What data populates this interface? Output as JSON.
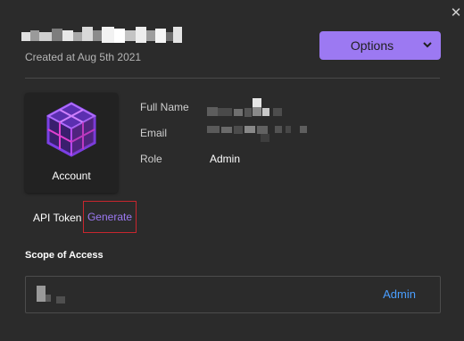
{
  "header": {
    "created": "Created at Aug 5th 2021",
    "options_label": "Options",
    "close_icon": "close-icon",
    "chevron_icon": "chevron-down-icon"
  },
  "account_card": {
    "label": "Account",
    "icon": "cube-logo-icon"
  },
  "fields": [
    {
      "label": "Full Name",
      "value": ""
    },
    {
      "label": "Email",
      "value": ""
    },
    {
      "label": "Role",
      "value": "Admin"
    }
  ],
  "api_token": {
    "label": "API Token",
    "action": "Generate"
  },
  "scope": {
    "title": "Scope of Access",
    "role": "Admin"
  },
  "colors": {
    "accent": "#9c79f2",
    "link": "#4a9eff",
    "highlight_border": "#c8262e",
    "background": "#2b2b2b"
  }
}
